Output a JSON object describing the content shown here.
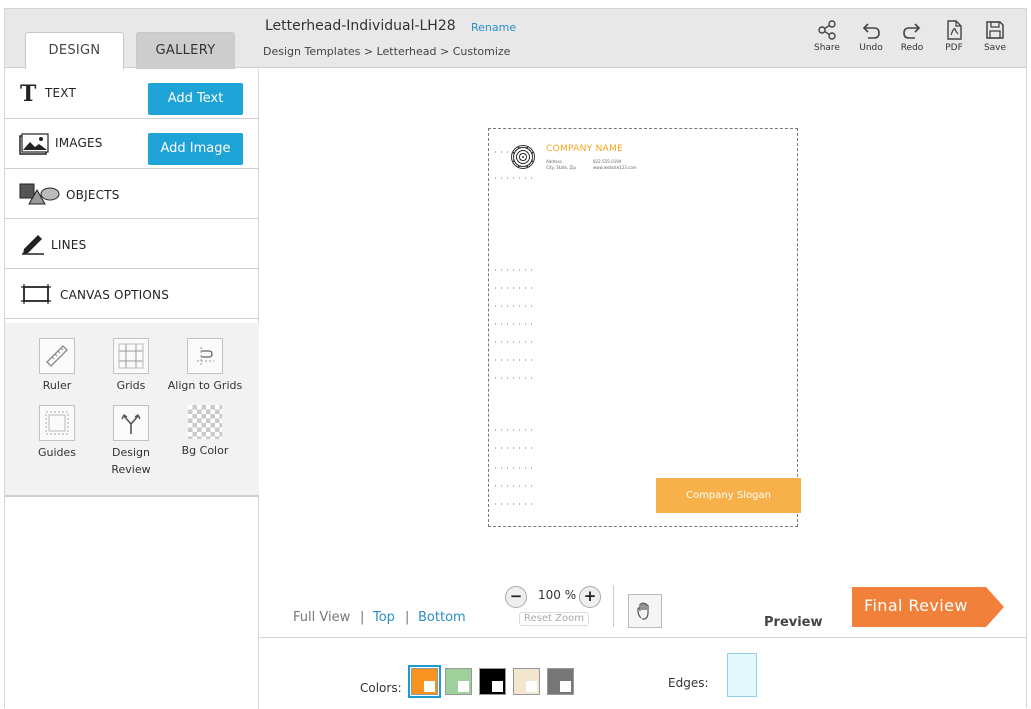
{
  "header": {
    "doc_title": "Letterhead-Individual-LH28",
    "rename": "Rename",
    "breadcrumb": "Design Templates > Letterhead > Customize",
    "tabs": {
      "design": "DESIGN",
      "gallery": "GALLERY"
    },
    "tools": {
      "share": "Share",
      "undo": "Undo",
      "redo": "Redo",
      "pdf": "PDF",
      "save": "Save"
    }
  },
  "sidebar": {
    "text": {
      "label": "TEXT",
      "button": "Add Text"
    },
    "images": {
      "label": "IMAGES",
      "button": "Add Image"
    },
    "objects": {
      "label": "OBJECTS"
    },
    "lines": {
      "label": "LINES"
    },
    "canvas_options": {
      "label": "CANVAS OPTIONS"
    },
    "options": {
      "ruler": "Ruler",
      "grids": "Grids",
      "align": "Align to Grids",
      "guides": "Guides",
      "design_review": "Design\nReview",
      "bg_color": "Bg Color"
    }
  },
  "canvas": {
    "company_name": "COMPANY NAME",
    "address": "Address",
    "city": "City, State, Zip",
    "phone": "922-555-0194",
    "website": "www.website123.com",
    "slogan": "Company Slogan"
  },
  "controls": {
    "full_view": "Full View",
    "sep": "|",
    "top": "Top",
    "bottom": "Bottom",
    "zoom": "100 %",
    "reset_zoom": "Reset Zoom",
    "preview": "Preview",
    "final_review": "Final Review",
    "colors_label": "Colors:",
    "edges_label": "Edges:"
  },
  "colors": {
    "accent_blue": "#1ea3d6",
    "brand_orange": "#f5a623",
    "final_review": "#f0803a",
    "swatches": [
      "#f7931e",
      "#9fcf9a",
      "#000000",
      "#f3e6cf",
      "#777777"
    ]
  }
}
